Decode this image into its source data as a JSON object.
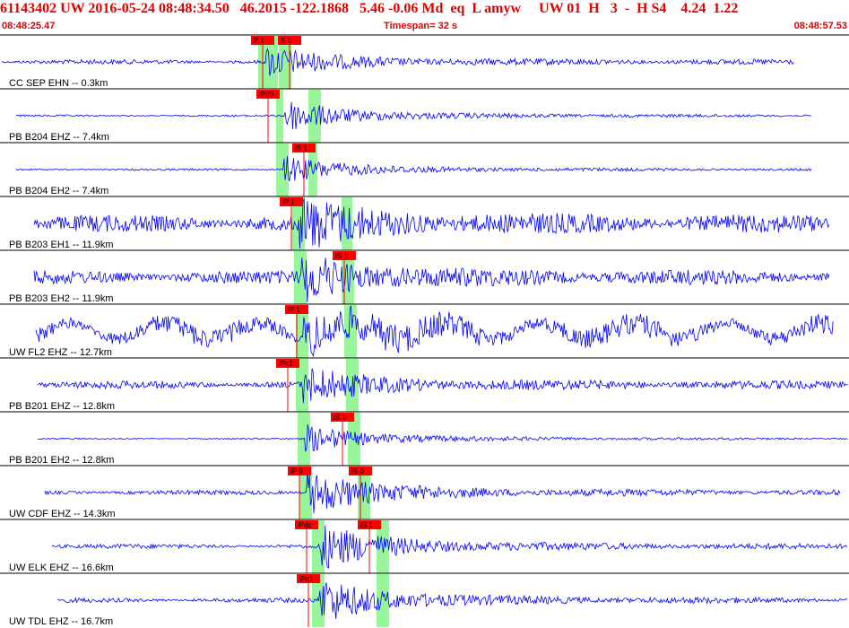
{
  "header": {
    "title": "61143402 UW 2016-05-24 08:48:34.50   46.2015 -122.1868   5.46 -0.06 Md  eq  L amyw     UW 01  H   3  -  H S4    4.24  1.22",
    "start_time": "08:48:25.47",
    "timespan": "Timespan=  32 s",
    "end_time": "08:48:57.53"
  },
  "colors": {
    "accent": "#e00000",
    "trace": "#0000ff",
    "pick_box": "#ff0000",
    "window": "#99f599",
    "grid": "#000000"
  },
  "traces": [
    {
      "label": "CC SEP EHN -- 0.3km",
      "picks": [
        "P 1",
        "S 1"
      ],
      "amp": 0.55,
      "noise": 0.12
    },
    {
      "label": "PB B204 EHZ -- 7.4km",
      "picks": [
        "iPd0"
      ],
      "amp": 0.6,
      "noise": 0.05
    },
    {
      "label": "PB B204 EH2 -- 7.4km",
      "picks": [
        "iS 1"
      ],
      "amp": 0.5,
      "noise": 0.05
    },
    {
      "label": "PB B203 EH1 -- 11.9km",
      "picks": [
        "iP 1"
      ],
      "amp": 0.8,
      "noise": 0.45
    },
    {
      "label": "PB B203 EH2 -- 11.9km",
      "picks": [
        "iS 1"
      ],
      "amp": 0.8,
      "noise": 0.35
    },
    {
      "label": "UW FL2 EHZ -- 12.7km",
      "picks": [
        "iP 1"
      ],
      "amp": 0.7,
      "noise": 0.5
    },
    {
      "label": "PB B201 EHZ -- 12.8km",
      "picks": [
        "iPc1"
      ],
      "amp": 0.6,
      "noise": 0.2
    },
    {
      "label": "PB B201 EH2 -- 12.8km",
      "picks": [
        "iS 1"
      ],
      "amp": 0.5,
      "noise": 0.04
    },
    {
      "label": "UW CDF EHZ -- 14.3km",
      "picks": [
        "iP 0",
        "iS 0"
      ],
      "amp": 0.8,
      "noise": 0.12
    },
    {
      "label": "UW ELK EHZ -- 16.6km",
      "picks": [
        "iPdc",
        "iS 1"
      ],
      "amp": 0.8,
      "noise": 0.12
    },
    {
      "label": "UW TDL EHZ -- 16.7km",
      "picks": [
        "iPc1"
      ],
      "amp": 0.8,
      "noise": 0.12
    }
  ]
}
